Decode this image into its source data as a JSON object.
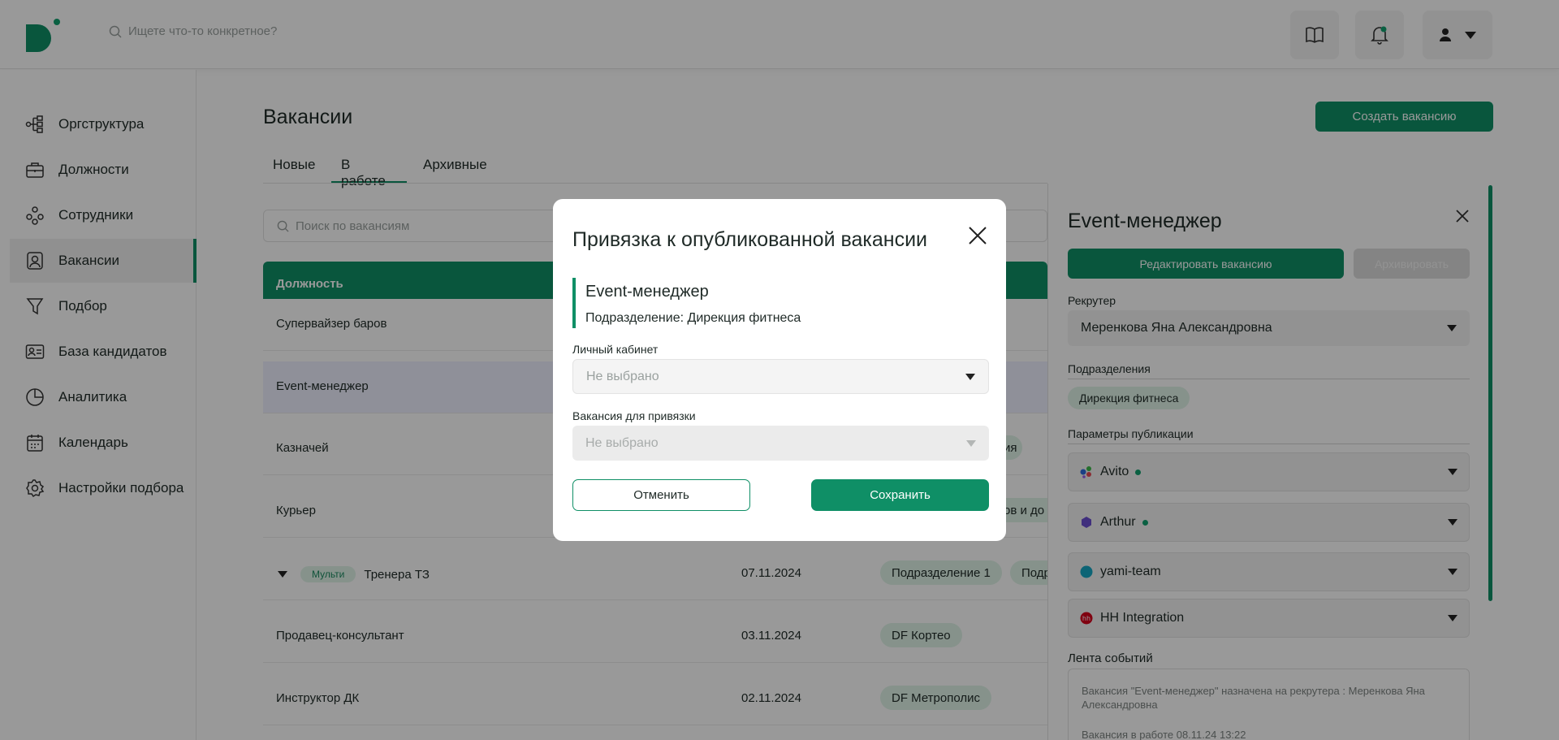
{
  "header": {
    "search_placeholder": "Ищете что-то конкретное?",
    "icons": [
      "book-icon",
      "bell-icon",
      "user-icon",
      "chevron-down-icon"
    ]
  },
  "sidebar": {
    "items": [
      {
        "label": "Оргструктура",
        "icon": "org-structure-icon"
      },
      {
        "label": "Должности",
        "icon": "briefcase-icon"
      },
      {
        "label": "Сотрудники",
        "icon": "people-icon"
      },
      {
        "label": "Вакансии",
        "icon": "vacancy-icon",
        "active": true
      },
      {
        "label": "Подбор",
        "icon": "funnel-icon"
      },
      {
        "label": "База кандидатов",
        "icon": "id-card-icon"
      },
      {
        "label": "Аналитика",
        "icon": "pie-chart-icon"
      },
      {
        "label": "Календарь",
        "icon": "calendar-icon"
      },
      {
        "label": "Настройки подбора",
        "icon": "gear-icon"
      }
    ]
  },
  "main": {
    "title": "Вакансии",
    "create_button": "Создать вакансию",
    "tabs": [
      {
        "label": "Новые"
      },
      {
        "label": "В работе",
        "active": true
      },
      {
        "label": "Архивные"
      }
    ],
    "search_placeholder": "Поиск по вакансиям",
    "table": {
      "header": "Должность",
      "rows": [
        {
          "position": "Супервайзер баров",
          "date": "",
          "chips": []
        },
        {
          "position": "Event-менеджер",
          "date": "",
          "chips": []
        },
        {
          "position": "Казначей",
          "date": "",
          "chips": [
            "ия"
          ]
        },
        {
          "position": "Курьер",
          "date": "",
          "chips": [
            "ов и до"
          ]
        },
        {
          "position": "Тренера ТЗ",
          "badge": "Мульти",
          "date": "07.11.2024",
          "chips": [
            "Подразделение 1",
            "Подр"
          ]
        },
        {
          "position": "Продавец-консультант",
          "date": "03.11.2024",
          "chips": [
            "DF Кортео"
          ]
        },
        {
          "position": "Инструктор ДК",
          "date": "02.11.2024",
          "chips": [
            "DF Метрополис"
          ]
        }
      ]
    }
  },
  "panel": {
    "title": "Event-менеджер",
    "edit_button": "Редактировать вакансию",
    "archive_button": "Архивировать",
    "recruiter_label": "Рекрутер",
    "recruiter_value": "Меренкова Яна Александровна",
    "departments_label": "Подразделения",
    "department_chip": "Дирекция фитнеса",
    "publication_label": "Параметры публикации",
    "publications": [
      {
        "name": "Avito",
        "icon": "avito-logo-icon",
        "active": true
      },
      {
        "name": "Arthur",
        "icon": "arthur-logo-icon",
        "active": true
      },
      {
        "name": "yami-team",
        "icon": "yami-logo-icon",
        "active": false
      },
      {
        "name": "HH Integration",
        "icon": "hh-logo-icon",
        "active": false
      }
    ],
    "feed_label": "Лента событий",
    "feed": [
      "Вакансия \"Event-менеджер\" назначена на рекрутера : Меренкова Яна Александровна",
      "Вакансия в работе 08.11.24 13:22"
    ]
  },
  "modal": {
    "title": "Привязка к опубликованной вакансии",
    "vacancy_name": "Event-менеджер",
    "vacancy_department": "Подразделение: Дирекция фитнеса",
    "cabinet_label": "Личный кабинет",
    "cabinet_value": "Не выбрано",
    "vacancy_label": "Вакансия для привязки",
    "vacancy_value": "Не выбрано",
    "cancel_button": "Отменить",
    "save_button": "Сохранить"
  },
  "colors": {
    "accent": "#0f8f66",
    "chip": "#dff3e8",
    "overlay": "rgba(0,0,0,0.4)"
  }
}
